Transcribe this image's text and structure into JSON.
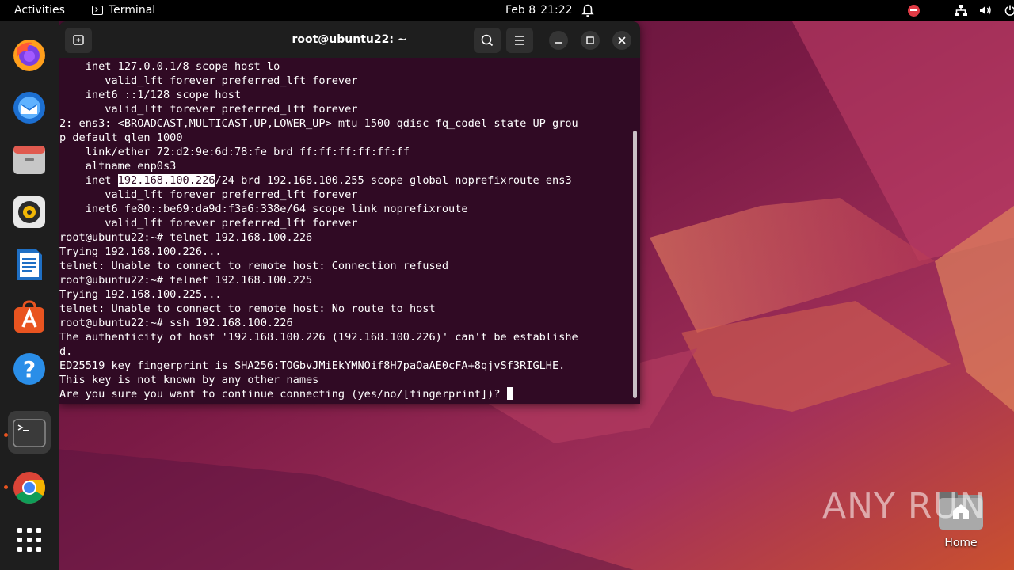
{
  "topbar": {
    "activities": "Activities",
    "app_name": "Terminal",
    "date": "Feb 8",
    "time": "21:22"
  },
  "dock": {
    "items": [
      "firefox-icon",
      "thunderbird-icon",
      "files-icon",
      "rhythmbox-icon",
      "libreoffice-writer-icon",
      "app-center-icon",
      "help-icon",
      "terminal-icon",
      "chrome-icon",
      "show-apps-icon"
    ],
    "active": "terminal-icon"
  },
  "terminal": {
    "title": "root@ubuntu22: ~",
    "lines": [
      "    inet 127.0.0.1/8 scope host lo",
      "       valid_lft forever preferred_lft forever",
      "    inet6 ::1/128 scope host",
      "       valid_lft forever preferred_lft forever",
      "2: ens3: <BROADCAST,MULTICAST,UP,LOWER_UP> mtu 1500 qdisc fq_codel state UP grou",
      "p default qlen 1000",
      "    link/ether 72:d2:9e:6d:78:fe brd ff:ff:ff:ff:ff:ff",
      "    altname enp0s3",
      "@@HL@@",
      "       valid_lft forever preferred_lft forever",
      "    inet6 fe80::be69:da9d:f3a6:338e/64 scope link noprefixroute",
      "       valid_lft forever preferred_lft forever",
      "root@ubuntu22:~# telnet 192.168.100.226",
      "Trying 192.168.100.226...",
      "telnet: Unable to connect to remote host: Connection refused",
      "root@ubuntu22:~# telnet 192.168.100.225",
      "Trying 192.168.100.225...",
      "telnet: Unable to connect to remote host: No route to host",
      "root@ubuntu22:~# ssh 192.168.100.226",
      "The authenticity of host '192.168.100.226 (192.168.100.226)' can't be establishe",
      "d.",
      "ED25519 key fingerprint is SHA256:TOGbvJMiEkYMNOif8H7paOaAE0cFA+8qjvSf3RIGLHE.",
      "This key is not known by any other names",
      "@@PROMPT@@"
    ],
    "highlight_line": {
      "before": "    inet ",
      "selected": "192.168.100.226",
      "after": "/24 brd 192.168.100.255 scope global noprefixroute ens3"
    },
    "prompt_line": "Are you sure you want to continue connecting (yes/no/[fingerprint])? "
  },
  "desktop": {
    "home_label": "Home",
    "watermark": "ANY RUN"
  },
  "colors": {
    "terminal_bg": "#300a24",
    "topbar_bg": "#000000",
    "dock_bg": "#1e1e1e",
    "accent": "#e95420"
  }
}
